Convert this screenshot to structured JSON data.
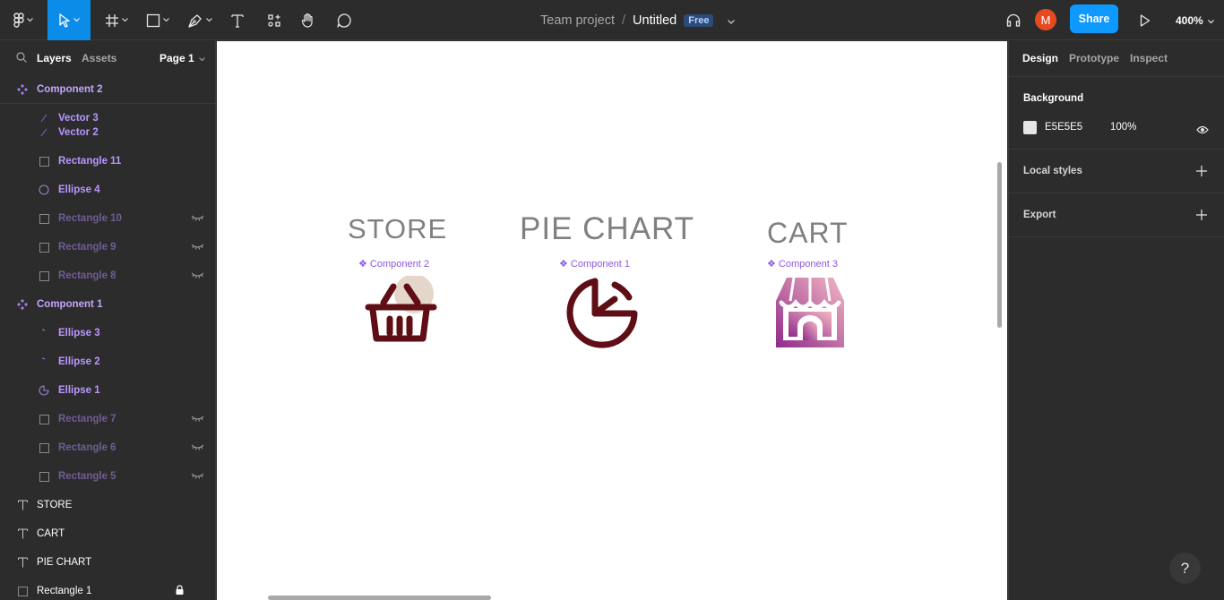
{
  "topbar": {
    "tools": [
      {
        "name": "main-menu",
        "icon": "figma-logo-icon"
      },
      {
        "name": "move-tool",
        "icon": "cursor-arrow-icon",
        "active": true
      },
      {
        "name": "frame-tool",
        "icon": "frame-grid-icon"
      },
      {
        "name": "shape-tool",
        "icon": "rectangle-icon"
      },
      {
        "name": "pen-tool",
        "icon": "pen-icon"
      },
      {
        "name": "text-tool",
        "icon": "text-t-icon"
      },
      {
        "name": "resources-tool",
        "icon": "components-icon"
      },
      {
        "name": "hand-tool",
        "icon": "hand-icon"
      },
      {
        "name": "comment-tool",
        "icon": "comment-bubble-icon"
      }
    ],
    "breadcrumb": "Team project",
    "separator": "/",
    "file_name": "Untitled",
    "plan_badge": "Free",
    "avatar_initial": "M",
    "share_label": "Share",
    "zoom": "400%",
    "accent_color": "#0d99ff"
  },
  "left_panel": {
    "tabs": [
      "Layers",
      "Assets"
    ],
    "page": "Page 1",
    "layers": [
      {
        "label": "Component 2",
        "icon": "component-icon",
        "indent": 0,
        "hidden": false,
        "locked": false,
        "kind": "component"
      },
      {
        "label": "Vector 3",
        "icon": "vector-line-icon",
        "indent": 1,
        "hidden": false,
        "locked": false,
        "kind": "child"
      },
      {
        "label": "Vector 2",
        "icon": "vector-line-icon",
        "indent": 1,
        "hidden": false,
        "locked": false,
        "kind": "child"
      },
      {
        "label": "Rectangle 11",
        "icon": "rectangle-outline-icon",
        "indent": 1,
        "hidden": false,
        "locked": false,
        "kind": "child"
      },
      {
        "label": "Ellipse 4",
        "icon": "ellipse-outline-icon",
        "indent": 1,
        "hidden": false,
        "locked": false,
        "kind": "child"
      },
      {
        "label": "Rectangle 10",
        "icon": "rectangle-outline-icon",
        "indent": 1,
        "hidden": true,
        "locked": false,
        "kind": "child"
      },
      {
        "label": "Rectangle 9",
        "icon": "rectangle-outline-icon",
        "indent": 1,
        "hidden": true,
        "locked": false,
        "kind": "child"
      },
      {
        "label": "Rectangle 8",
        "icon": "rectangle-outline-icon",
        "indent": 1,
        "hidden": true,
        "locked": false,
        "kind": "child"
      },
      {
        "label": "Component 1",
        "icon": "component-icon",
        "indent": 0,
        "hidden": false,
        "locked": false,
        "kind": "component"
      },
      {
        "label": "Ellipse 3",
        "icon": "ellipse-arc-icon",
        "indent": 1,
        "hidden": false,
        "locked": false,
        "kind": "child"
      },
      {
        "label": "Ellipse 2",
        "icon": "ellipse-arc-icon",
        "indent": 1,
        "hidden": false,
        "locked": false,
        "kind": "child"
      },
      {
        "label": "Ellipse 1",
        "icon": "ellipse-pie-icon",
        "indent": 1,
        "hidden": false,
        "locked": false,
        "kind": "child"
      },
      {
        "label": "Rectangle 7",
        "icon": "rectangle-outline-icon",
        "indent": 1,
        "hidden": true,
        "locked": false,
        "kind": "child"
      },
      {
        "label": "Rectangle 6",
        "icon": "rectangle-outline-icon",
        "indent": 1,
        "hidden": true,
        "locked": false,
        "kind": "child"
      },
      {
        "label": "Rectangle 5",
        "icon": "rectangle-outline-icon",
        "indent": 1,
        "hidden": true,
        "locked": false,
        "kind": "child"
      },
      {
        "label": "STORE",
        "icon": "text-t-icon",
        "indent": 0,
        "hidden": false,
        "locked": false,
        "kind": "text"
      },
      {
        "label": "CART",
        "icon": "text-t-icon",
        "indent": 0,
        "hidden": false,
        "locked": false,
        "kind": "text"
      },
      {
        "label": "PIE CHART",
        "icon": "text-t-icon",
        "indent": 0,
        "hidden": false,
        "locked": false,
        "kind": "text"
      },
      {
        "label": "Rectangle 1",
        "icon": "rectangle-outline-icon",
        "indent": 0,
        "hidden": false,
        "locked": true,
        "kind": "text"
      }
    ]
  },
  "canvas": {
    "background": "#ffffff",
    "items": [
      {
        "title": "STORE",
        "component": "Component 2",
        "icon": "basket-icon"
      },
      {
        "title": "PIE CHART",
        "component": "Component 1",
        "icon": "pie-chart-icon"
      },
      {
        "title": "CART",
        "component": "Component 3",
        "icon": "storefront-icon"
      }
    ],
    "component_color": "#8d56e8",
    "icon_color": "#5e0e14"
  },
  "right_panel": {
    "tabs": [
      "Design",
      "Prototype",
      "Inspect"
    ],
    "background_heading": "Background",
    "background_hex": "E5E5E5",
    "background_opacity": "100%",
    "background_swatch": "#e5e5e5",
    "local_styles": "Local styles",
    "export": "Export"
  },
  "help_label": "?"
}
